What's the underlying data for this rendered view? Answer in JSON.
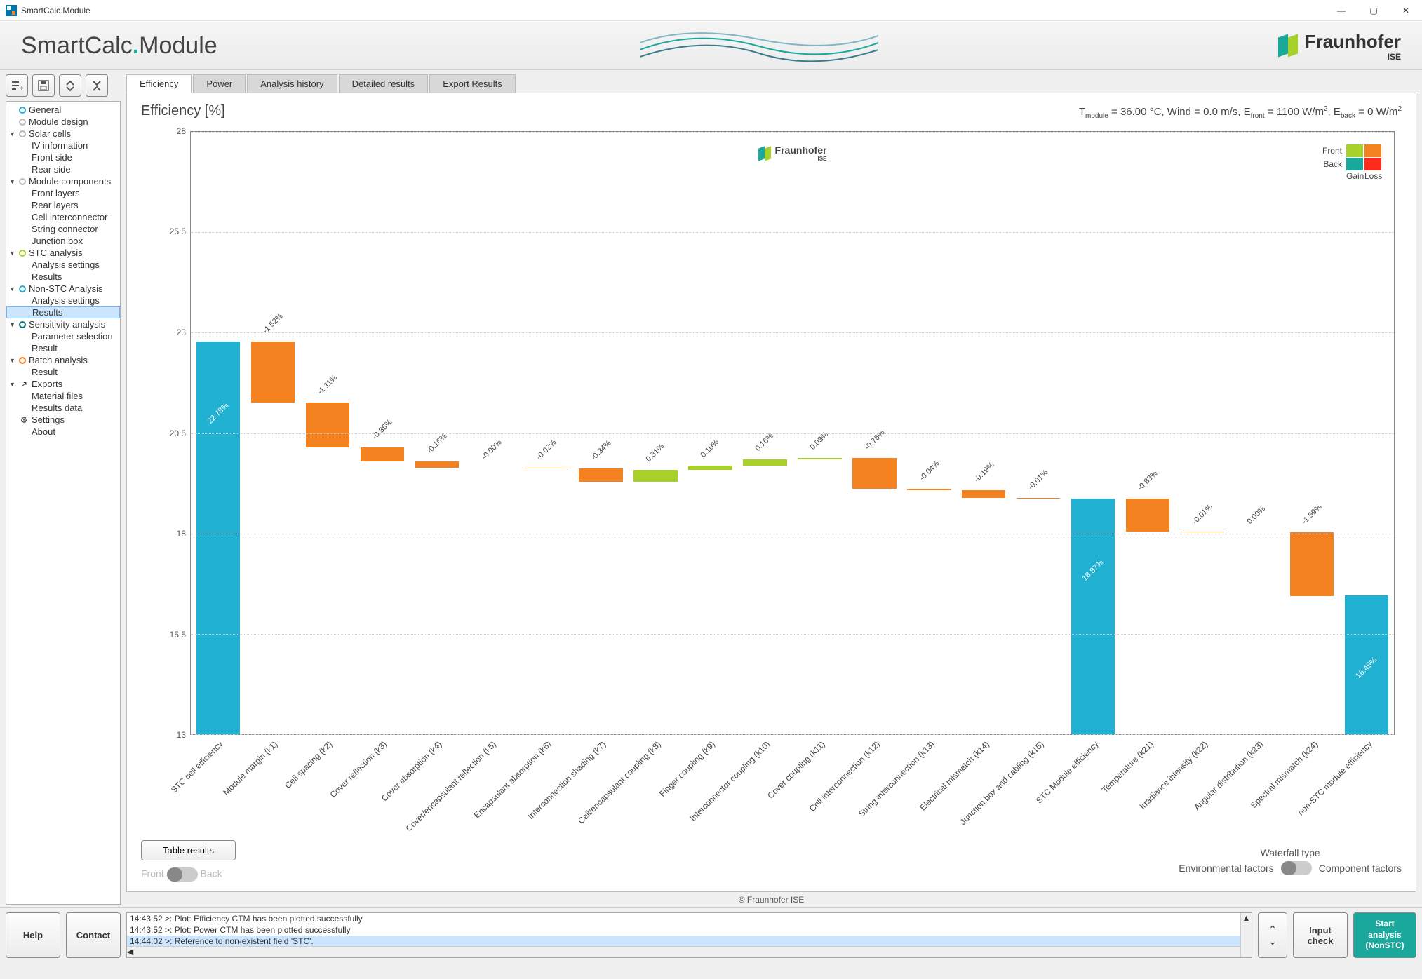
{
  "window": {
    "title": "SmartCalc.Module"
  },
  "header": {
    "logo_a": "SmartCalc",
    "logo_b": "Module",
    "fraunhofer": "Fraunhofer",
    "ise": "ISE"
  },
  "toolbar_icons": [
    "list-plus-icon",
    "save-icon",
    "expand-icon",
    "collapse-icon"
  ],
  "sidebar": [
    {
      "label": "General",
      "bullet": "#1fb0d2",
      "caret": "",
      "lvl": 0
    },
    {
      "label": "Module design",
      "bullet": "#bbb",
      "caret": "",
      "lvl": 0
    },
    {
      "label": "Solar cells",
      "bullet": "#bbb",
      "caret": "▼",
      "lvl": 0
    },
    {
      "label": "IV information",
      "lvl": 1
    },
    {
      "label": "Front side",
      "lvl": 1
    },
    {
      "label": "Rear side",
      "lvl": 1
    },
    {
      "label": "Module components",
      "bullet": "#bbb",
      "caret": "▼",
      "lvl": 0
    },
    {
      "label": "Front layers",
      "lvl": 1
    },
    {
      "label": "Rear layers",
      "lvl": 1
    },
    {
      "label": "Cell interconnector",
      "lvl": 1
    },
    {
      "label": "String connector",
      "lvl": 1
    },
    {
      "label": "Junction box",
      "lvl": 1
    },
    {
      "label": "STC analysis",
      "bullet": "#a7d129",
      "caret": "▼",
      "lvl": 0
    },
    {
      "label": "Analysis settings",
      "lvl": 1
    },
    {
      "label": "Results",
      "lvl": 1
    },
    {
      "label": "Non-STC Analysis",
      "bullet": "#1fb0d2",
      "caret": "▼",
      "lvl": 0
    },
    {
      "label": "Analysis settings",
      "lvl": 1
    },
    {
      "label": "Results",
      "lvl": 1,
      "selected": true
    },
    {
      "label": "Sensitivity analysis",
      "bullet": "#0b6e6e",
      "caret": "▼",
      "lvl": 0
    },
    {
      "label": "Parameter selection",
      "lvl": 1
    },
    {
      "label": "Result",
      "lvl": 1
    },
    {
      "label": "Batch analysis",
      "bullet": "#f58220",
      "caret": "▼",
      "lvl": 0
    },
    {
      "label": "Result",
      "lvl": 1
    },
    {
      "label": "Exports",
      "icon": "↗",
      "caret": "▼",
      "lvl": 0
    },
    {
      "label": "Material files",
      "lvl": 1
    },
    {
      "label": "Results data",
      "lvl": 1
    },
    {
      "label": "Settings",
      "icon": "⚙",
      "caret": "",
      "lvl": 0
    },
    {
      "label": "About",
      "caret": "",
      "lvl": 0
    }
  ],
  "tabs": [
    "Efficiency",
    "Power",
    "Analysis history",
    "Detailed results",
    "Export Results"
  ],
  "active_tab": 0,
  "chart": {
    "title": "Efficiency [%]",
    "conditions": "T<sub>module</sub> = 36.00 °C, Wind = 0.0 m/s,  E<sub>front</sub> = 1100 W/m<sup>2</sup>,  E<sub>back</sub> = 0 W/m<sup>2</sup>",
    "logo": "Fraunhofer",
    "ise": "ISE"
  },
  "legend": {
    "front": "Front",
    "back": "Back",
    "gain": "Gain",
    "loss": "Loss",
    "colors": {
      "front_gain": "#a7d129",
      "front_loss": "#f58220",
      "back_gain": "#1aa79c",
      "back_loss": "#ff2a1a"
    }
  },
  "below": {
    "table_results": "Table results",
    "front": "Front",
    "back": "Back",
    "waterfall": "Waterfall type",
    "env": "Environmental factors",
    "comp": "Component factors"
  },
  "copyright": "© Fraunhofer ISE",
  "bottom": {
    "help": "Help",
    "contact": "Contact",
    "input_check": "Input\ncheck",
    "start": "Start\nanalysis\n(NonSTC)"
  },
  "log": [
    "14:43:52 >: Plot: Efficiency CTM has been plotted successfully",
    "14:43:52 >: Plot: Power CTM has been plotted successfully",
    "14:44:02 >: Reference to non-existent field 'STC'."
  ],
  "chart_data": {
    "type": "bar",
    "title": "Efficiency [%]",
    "ylabel": "Efficiency [%]",
    "ylim": [
      13,
      28
    ],
    "yticks": [
      13,
      15.5,
      18,
      20.5,
      23,
      25.5,
      28
    ],
    "conditions": {
      "T_module_C": 36.0,
      "Wind_ms": 0.0,
      "E_front_Wm2": 1100,
      "E_back_Wm2": 0
    },
    "categories": [
      "STC cell efficiency",
      "Module margin (k1)",
      "Cell spacing (k2)",
      "Cover reflection (k3)",
      "Cover absorption (k4)",
      "Cover/encapsulant reflection (k5)",
      "Encapsulant absorption (k6)",
      "Interconnection shading (k7)",
      "Cell/encapsulant coupling (k8)",
      "Finger coupling (k9)",
      "Interconnector coupling (k10)",
      "Cover coupling (k11)",
      "Cell interconnection (k12)",
      "String interconnection (k13)",
      "Electrical mismatch (k14)",
      "Junction box and cabling (k15)",
      "STC Module efficiency",
      "Temperature (k21)",
      "Irradiance intensity (k22)",
      "Angular distribution (k23)",
      "Spectral mismatch (k24)",
      "non-STC module efficiency"
    ],
    "steps": [
      {
        "type": "absolute",
        "value": 22.78,
        "label": "22.78%",
        "color": "#1fb0d2"
      },
      {
        "type": "delta",
        "value": -1.52,
        "label": "-1.52%",
        "color": "#f58220"
      },
      {
        "type": "delta",
        "value": -1.11,
        "label": "-1.11%",
        "color": "#f58220"
      },
      {
        "type": "delta",
        "value": -0.35,
        "label": "-0.35%",
        "color": "#f58220"
      },
      {
        "type": "delta",
        "value": -0.16,
        "label": "-0.16%",
        "color": "#f58220"
      },
      {
        "type": "delta",
        "value": -0.0,
        "label": "-0.00%",
        "color": "#f58220"
      },
      {
        "type": "delta",
        "value": -0.02,
        "label": "-0.02%",
        "color": "#f58220"
      },
      {
        "type": "delta",
        "value": -0.34,
        "label": "-0.34%",
        "color": "#f58220"
      },
      {
        "type": "delta",
        "value": 0.31,
        "label": "0.31%",
        "color": "#a7d129"
      },
      {
        "type": "delta",
        "value": 0.1,
        "label": "0.10%",
        "color": "#a7d129"
      },
      {
        "type": "delta",
        "value": 0.16,
        "label": "0.16%",
        "color": "#a7d129"
      },
      {
        "type": "delta",
        "value": 0.03,
        "label": "0.03%",
        "color": "#a7d129"
      },
      {
        "type": "delta",
        "value": -0.76,
        "label": "-0.76%",
        "color": "#f58220"
      },
      {
        "type": "delta",
        "value": -0.04,
        "label": "-0.04%",
        "color": "#f58220"
      },
      {
        "type": "delta",
        "value": -0.19,
        "label": "-0.19%",
        "color": "#f58220"
      },
      {
        "type": "delta",
        "value": -0.01,
        "label": "-0.01%",
        "color": "#f58220"
      },
      {
        "type": "absolute",
        "value": 18.87,
        "label": "18.87%",
        "color": "#1fb0d2"
      },
      {
        "type": "delta",
        "value": -0.83,
        "label": "-0.83%",
        "color": "#f58220"
      },
      {
        "type": "delta",
        "value": -0.01,
        "label": "-0.01%",
        "color": "#f58220"
      },
      {
        "type": "delta",
        "value": 0.0,
        "label": "0.00%",
        "color": "#a7d129"
      },
      {
        "type": "delta",
        "value": -1.59,
        "label": "-1.59%",
        "color": "#f58220"
      },
      {
        "type": "absolute",
        "value": 16.45,
        "label": "16.45%",
        "color": "#1fb0d2"
      }
    ]
  }
}
